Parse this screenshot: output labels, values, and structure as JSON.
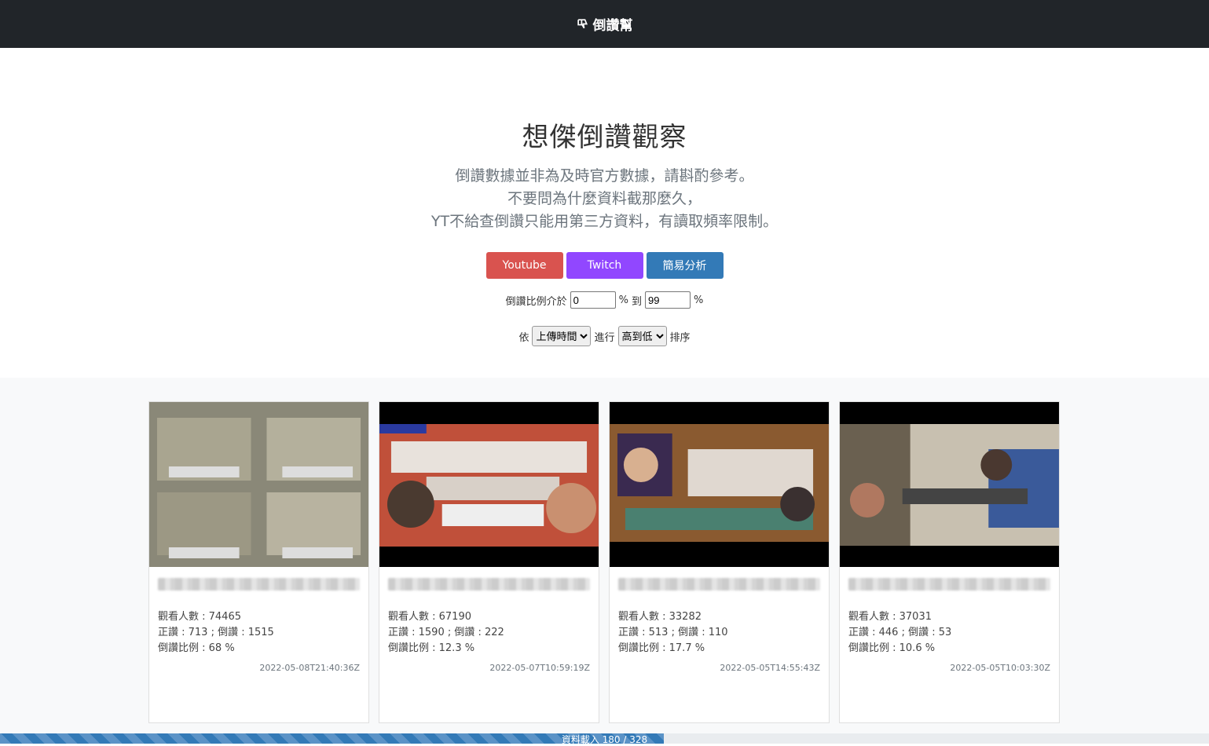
{
  "navbar": {
    "brand": "倒讚幫",
    "icon": "thumbs-down-icon"
  },
  "hero": {
    "title": "想傑倒讚觀察",
    "lines": [
      "倒讚數據並非為及時官方數據，請斟酌參考。",
      "不要問為什麼資料截那麼久，",
      "YT不給查倒讚只能用第三方資料，有讀取頻率限制。"
    ]
  },
  "buttons": {
    "youtube": "Youtube",
    "twitch": "Twitch",
    "analysis": "簡易分析"
  },
  "filter": {
    "label": "倒讚比例介於",
    "min": "0",
    "pct1": "%",
    "to": "到",
    "max": "99",
    "pct2": "%"
  },
  "sort": {
    "by": "依",
    "field": "上傳時間",
    "do": "進行",
    "order": "高到低",
    "suffix": "排序"
  },
  "videos": [
    {
      "views": "觀看人數 : 74465",
      "votes": "正讚 : 713 ; 倒讚 : 1515",
      "ratio": "倒讚比例 : 68 %",
      "date": "2022-05-08T21:40:36Z"
    },
    {
      "views": "觀看人數 : 67190",
      "votes": "正讚 : 1590 ; 倒讚 : 222",
      "ratio": "倒讚比例 : 12.3 %",
      "date": "2022-05-07T10:59:19Z"
    },
    {
      "views": "觀看人數 : 33282",
      "votes": "正讚 : 513 ; 倒讚 : 110",
      "ratio": "倒讚比例 : 17.7 %",
      "date": "2022-05-05T14:55:43Z"
    },
    {
      "views": "觀看人數 : 37031",
      "votes": "正讚 : 446 ; 倒讚 : 53",
      "ratio": "倒讚比例 : 10.6 %",
      "date": "2022-05-05T10:03:30Z"
    }
  ],
  "progress": {
    "text": "資料載入 180 / 328",
    "value": 0.549
  }
}
